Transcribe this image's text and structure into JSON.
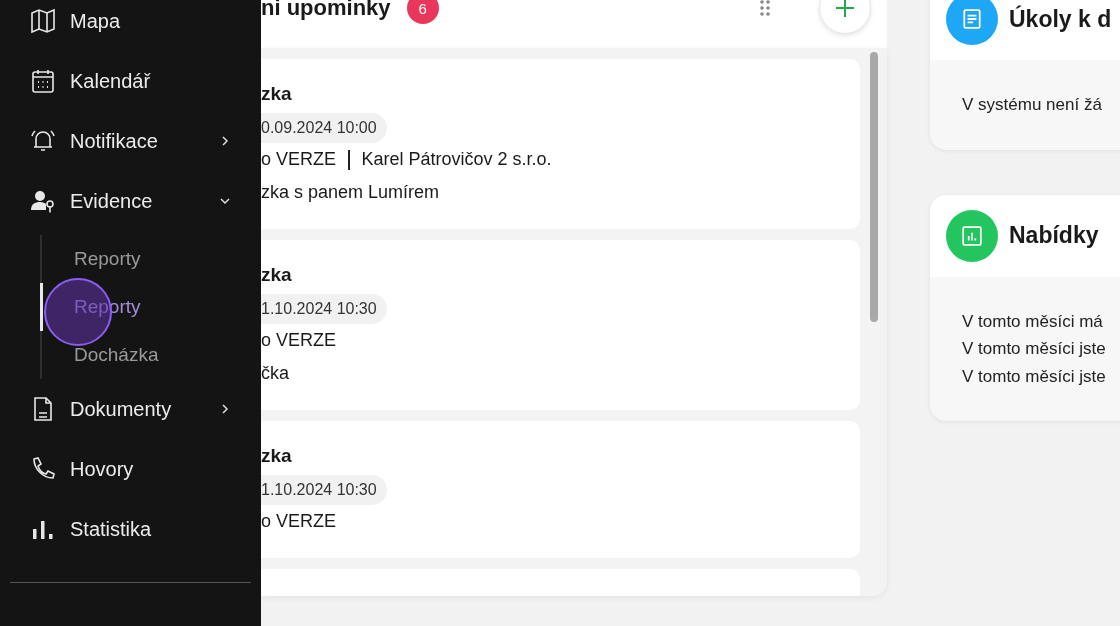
{
  "sidebar": {
    "items": [
      {
        "label": "Mapa"
      },
      {
        "label": "Kalendář"
      },
      {
        "label": "Notifikace",
        "expanded": false
      },
      {
        "label": "Evidence",
        "expanded": true,
        "children": [
          {
            "label": "Reporty",
            "selected": false
          },
          {
            "label": "Reporty",
            "selected": true
          },
          {
            "label": "Docházka",
            "selected": false
          }
        ]
      },
      {
        "label": "Dokumenty",
        "expanded": false
      },
      {
        "label": "Hovory"
      },
      {
        "label": "Statistika"
      }
    ]
  },
  "reminders": {
    "title": "ni upominky",
    "count": "6",
    "more_below": true,
    "items": [
      {
        "title": "zka",
        "date": "0.09.2024 10:00",
        "project": "o VERZE",
        "company": "Karel Pátrovičov 2 s.r.o.",
        "note": "zka s panem Lumírem"
      },
      {
        "title": "zka",
        "date": "1.10.2024 10:30",
        "project": "o VERZE",
        "note": "čka"
      },
      {
        "title": "zka",
        "date": "1.10.2024 10:30",
        "project": "o VERZE"
      }
    ]
  },
  "widgets": [
    {
      "title": "Úkoly k d",
      "color": "#1ea7f5",
      "lines": [
        "V systému není žá"
      ]
    },
    {
      "title": "Nabídky",
      "color": "#22c55e",
      "lines": [
        "V tomto měsíci má",
        "V tomto měsíci jste",
        "V tomto měsíci jste"
      ]
    }
  ]
}
